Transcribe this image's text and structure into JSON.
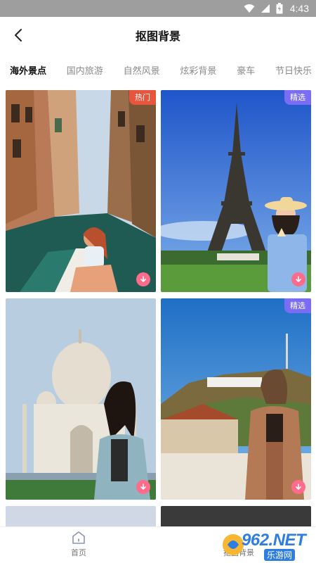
{
  "status_bar": {
    "time": "4:43"
  },
  "header": {
    "title": "抠图背景"
  },
  "tabs": [
    {
      "label": "海外景点",
      "active": true
    },
    {
      "label": "国内旅游",
      "active": false
    },
    {
      "label": "自然风景",
      "active": false
    },
    {
      "label": "炫彩背景",
      "active": false
    },
    {
      "label": "豪车",
      "active": false
    },
    {
      "label": "节日快乐",
      "active": false
    }
  ],
  "cards": [
    {
      "badge": "热门",
      "badge_type": "hot",
      "scene": "venice-canal"
    },
    {
      "badge": "精选",
      "badge_type": "pick",
      "scene": "eiffel-tower"
    },
    {
      "badge": "",
      "badge_type": "none",
      "scene": "taj-mahal"
    },
    {
      "badge": "精选",
      "badge_type": "pick",
      "scene": "hollywood-sign"
    }
  ],
  "bottom_nav": {
    "home": "首页",
    "cutout": "抠图背景"
  },
  "watermark": {
    "brand": "962.NET",
    "sub": "乐游网"
  },
  "colors": {
    "hot_badge": "#e8543c",
    "pick_badge": "#7b6cf6",
    "download_button": "#ff6b8b"
  }
}
